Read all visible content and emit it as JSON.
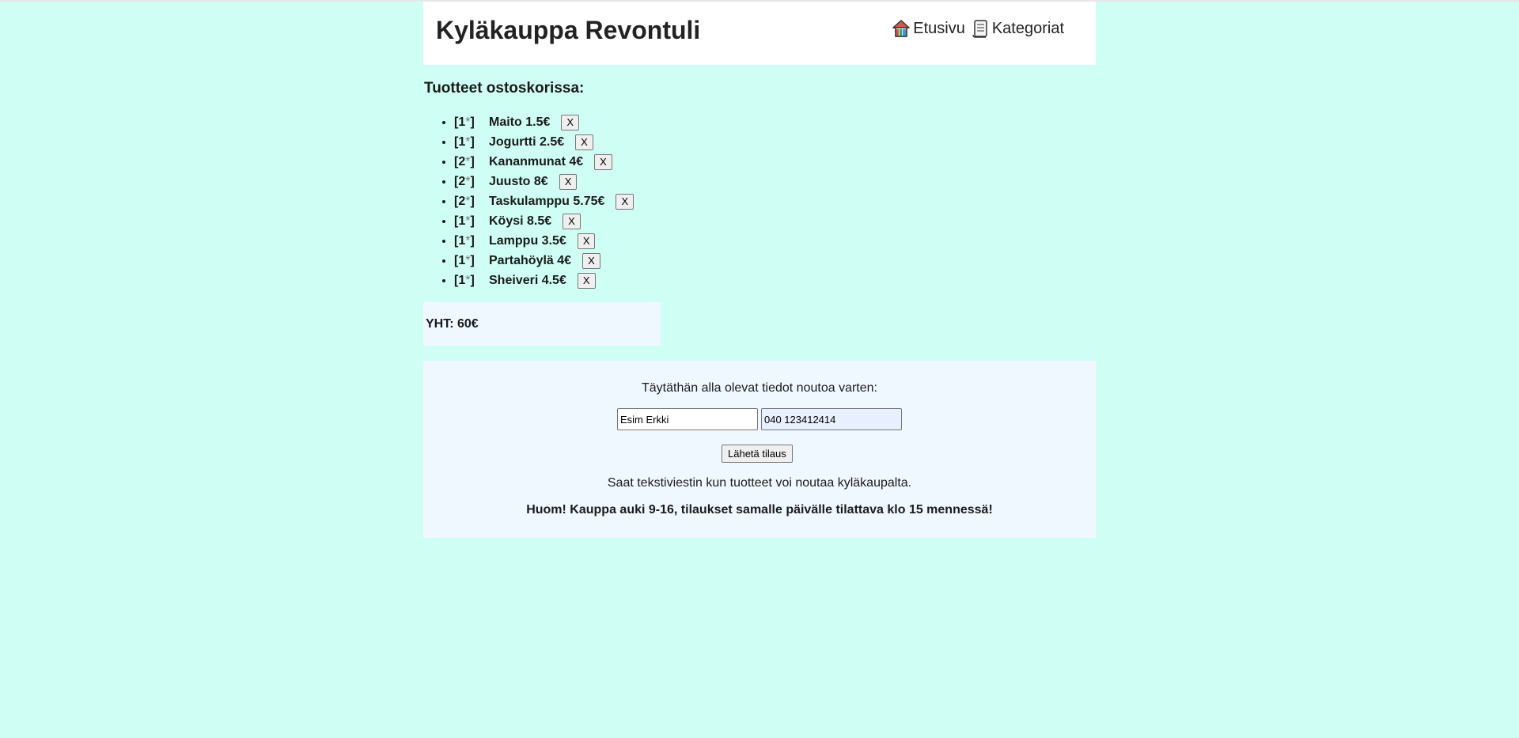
{
  "header": {
    "title": "Kyläkauppa Revontuli",
    "nav": [
      {
        "label": "Etusivu",
        "icon": "house-icon"
      },
      {
        "label": "Kategoriat",
        "icon": "scroll-icon"
      }
    ]
  },
  "cart": {
    "heading": "Tuotteet ostoskorissa:",
    "remove_label": "X",
    "items": [
      {
        "qty": "[1",
        "star": "*",
        "close": "]",
        "text": "Maito 1.5€"
      },
      {
        "qty": "[1",
        "star": "*",
        "close": "]",
        "text": "Jogurtti 2.5€"
      },
      {
        "qty": "[2",
        "star": "*",
        "close": "]",
        "text": "Kananmunat 4€"
      },
      {
        "qty": "[2",
        "star": "*",
        "close": "]",
        "text": "Juusto 8€"
      },
      {
        "qty": "[2",
        "star": "*",
        "close": "]",
        "text": "Taskulamppu 5.75€"
      },
      {
        "qty": "[1",
        "star": "*",
        "close": "]",
        "text": "Köysi 8.5€"
      },
      {
        "qty": "[1",
        "star": "*",
        "close": "]",
        "text": "Lamppu 3.5€"
      },
      {
        "qty": "[1",
        "star": "*",
        "close": "]",
        "text": "Partahöylä 4€"
      },
      {
        "qty": "[1",
        "star": "*",
        "close": "]",
        "text": "Sheiveri 4.5€"
      }
    ],
    "total": "YHT: 60€"
  },
  "order_form": {
    "intro": "Täytäthän alla olevat tiedot noutoa varten:",
    "name_value": "Esim Erkki",
    "phone_value": "040 123412414",
    "submit_label": "Lähetä tilaus",
    "sms_note": "Saat tekstiviestin kun tuotteet voi noutaa kyläkaupalta.",
    "hours_note": "Huom! Kauppa auki 9-16, tilaukset samalle päivälle tilattava klo 15 mennessä!"
  }
}
